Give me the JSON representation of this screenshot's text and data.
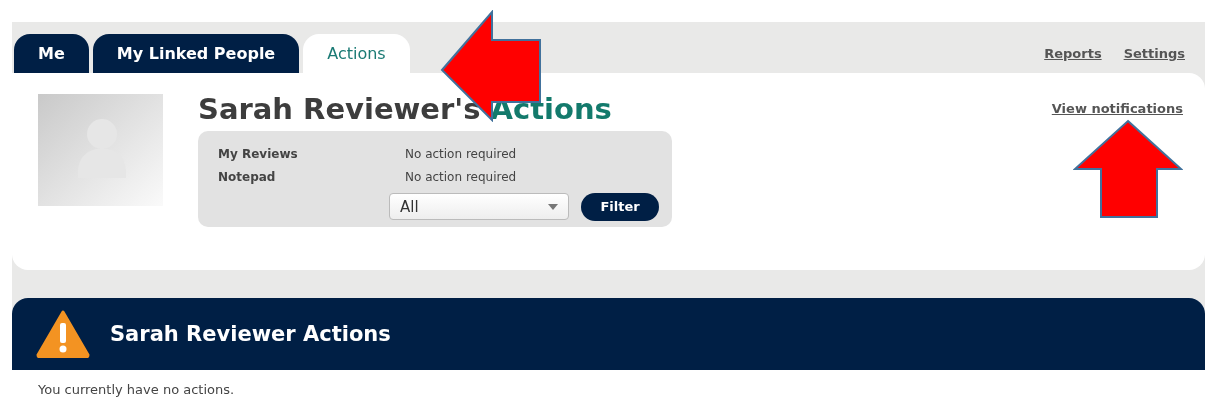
{
  "tabs": [
    {
      "label": "Me",
      "selected": false
    },
    {
      "label": "My Linked People",
      "selected": false
    },
    {
      "label": "Actions",
      "selected": true
    }
  ],
  "top_links": [
    "Reports",
    "Settings"
  ],
  "heading": {
    "prefix": "Sarah Reviewer's",
    "accent": "Actions"
  },
  "notifications_link": "View notifications",
  "summary": [
    {
      "label": "My Reviews",
      "status": "No action required"
    },
    {
      "label": "Notepad",
      "status": "No action required"
    }
  ],
  "filter": {
    "value": "All",
    "button": "Filter"
  },
  "actions_panel": {
    "title": "Sarah Reviewer Actions",
    "message": "You currently have no actions."
  }
}
